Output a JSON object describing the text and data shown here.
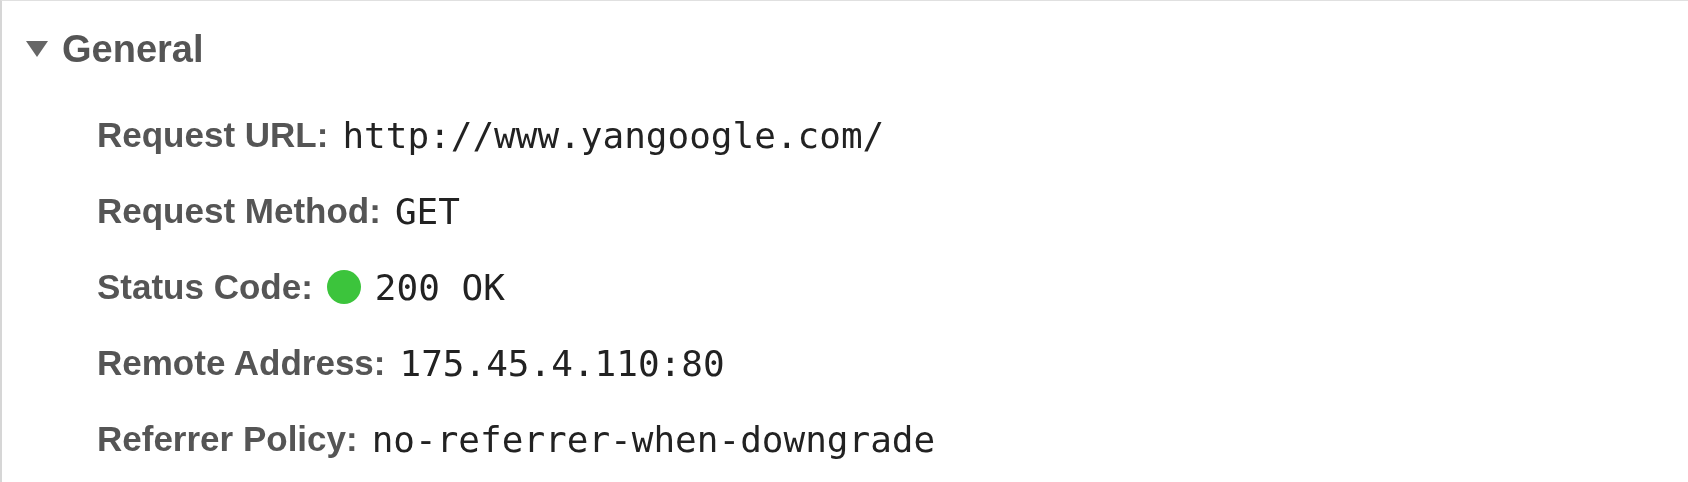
{
  "section": {
    "title": "General",
    "expanded": true,
    "rows": [
      {
        "label": "Request URL:",
        "value": "http://www.yangoogle.com/"
      },
      {
        "label": "Request Method:",
        "value": "GET"
      },
      {
        "label": "Status Code:",
        "value": "200 OK",
        "color": "#3cc43c"
      },
      {
        "label": "Remote Address:",
        "value": "175.45.4.110:80"
      },
      {
        "label": "Referrer Policy:",
        "value": "no-referrer-when-downgrade"
      }
    ]
  }
}
